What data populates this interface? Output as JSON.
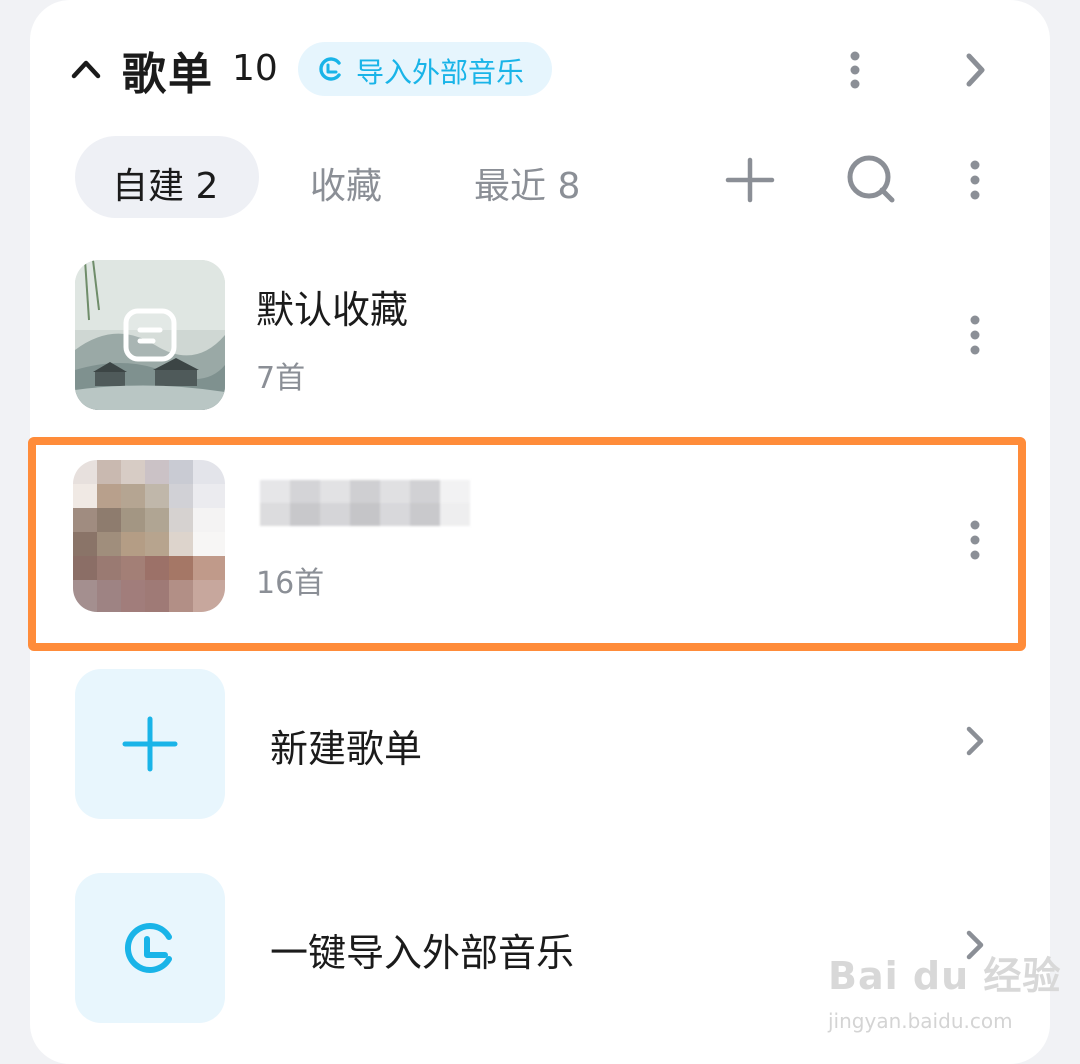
{
  "header": {
    "title": "歌单",
    "count": "10",
    "import_label": "导入外部音乐"
  },
  "tabs": [
    {
      "label": "自建 2",
      "active": true
    },
    {
      "label": "收藏",
      "active": false
    },
    {
      "label": "最近 8",
      "active": false
    }
  ],
  "playlists": [
    {
      "title": "默认收藏",
      "count": "7首"
    },
    {
      "title": "",
      "count": "16首"
    }
  ],
  "actions": [
    {
      "label": "新建歌单",
      "icon": "plus-icon"
    },
    {
      "label": "一键导入外部音乐",
      "icon": "import-icon"
    }
  ],
  "watermark": {
    "logo": "Bai du 经验",
    "url": "jingyan.baidu.com"
  },
  "colors": {
    "accent": "#19b4e8",
    "highlight": "#ff8c3a",
    "text": "#1b1b1b",
    "secondary": "#8b8f96"
  }
}
